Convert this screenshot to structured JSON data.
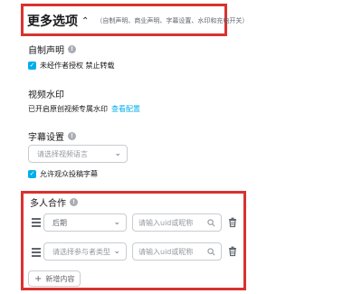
{
  "header": {
    "title": "更多选项",
    "subtitle": "（自制声明、商业声明、字幕设置、水印和充电开关）"
  },
  "declaration": {
    "label": "自制声明",
    "checkbox_label": "未经作者授权 禁止转载",
    "checked": true
  },
  "watermark": {
    "label": "视频水印",
    "status_text": "已开启原创视频专属水印",
    "link_text": "查看配置"
  },
  "subtitles": {
    "label": "字幕设置",
    "language_placeholder": "请选择视频语言",
    "allow_label": "允许观众投稿字幕",
    "allow_checked": true
  },
  "collab": {
    "label": "多人合作",
    "rows": [
      {
        "role": "后期",
        "role_is_placeholder": false,
        "uid_placeholder": "请输入uid或昵称"
      },
      {
        "role": "请选择参与者类型",
        "role_is_placeholder": true,
        "uid_placeholder": "请输入uid或昵称"
      }
    ],
    "add_label": "新增内容"
  },
  "colors": {
    "accent": "#00aeec",
    "highlight_box": "#d9322f"
  },
  "icons": [
    "chevron-up-icon",
    "help-icon",
    "checkbox-checked-icon",
    "chevron-down-icon",
    "search-icon",
    "drag-handle-icon",
    "trash-icon",
    "plus-icon"
  ]
}
